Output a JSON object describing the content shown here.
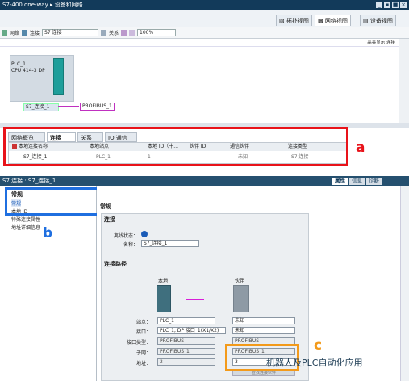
{
  "title": "S7-400 one-way ▸ 设备和网络",
  "window_buttons": [
    "_",
    "▪",
    "■",
    "×"
  ],
  "view_tabs": [
    "拓扑视图",
    "网络视图",
    "设备视图"
  ],
  "toolbar": {
    "network": "网络",
    "connection": "连接",
    "connection_type": "S7 连接",
    "relation": "关系",
    "zoom": "100%"
  },
  "highlight_link": "高亮显示 连接",
  "plc": {
    "name": "PLC_1",
    "cpu": "CPU 414-3 DP",
    "conn_label": "S7_连接_1",
    "bus_label": "PROFIBUS_1"
  },
  "lower_tabs": [
    "网络概览",
    "连接",
    "关系",
    "IO 通信"
  ],
  "grid": {
    "headers": [
      "本地连接名称",
      "本地站点",
      "本地 ID（十...",
      "伙伴 ID",
      "通信伙伴",
      "连接类型"
    ],
    "row": [
      "S7_连接_1",
      "PLC_1",
      "1",
      "",
      "未知",
      "S7 连接"
    ]
  },
  "annotations": {
    "a": "a",
    "b": "b",
    "c": "c"
  },
  "props": {
    "title": "S7 连接 : S7_连接_1",
    "tabs": [
      "属性",
      "信息",
      "诊断"
    ],
    "nav_header": "常规",
    "nav": [
      "常规",
      "本地 ID",
      "特殊连接属性",
      "地址详细信息"
    ],
    "section_title": "常规",
    "conn_section": "连接",
    "status_label": "离线状态：",
    "name_label": "名称：",
    "name_value": "S7_连接_1",
    "path_section": "连接路径",
    "local": "本地",
    "partner": "伙伴",
    "rows": [
      {
        "label": "站点：",
        "local": "PLC_1",
        "partner": "未知"
      },
      {
        "label": "接口：",
        "local": "PLC_1, DP 接口_1(X1/X2)",
        "partner": "未知"
      },
      {
        "label": "接口类型：",
        "local": "PROFIBUS",
        "partner": "PROFIBUS"
      },
      {
        "label": "子网：",
        "local": "PROFIBUS_1",
        "partner": "PROFIBUS_1"
      },
      {
        "label": "地址：",
        "local": "2",
        "partner": "3"
      }
    ],
    "find_button": "查找连接伙伴"
  },
  "watermark": "机器人及PLC自动化应用"
}
